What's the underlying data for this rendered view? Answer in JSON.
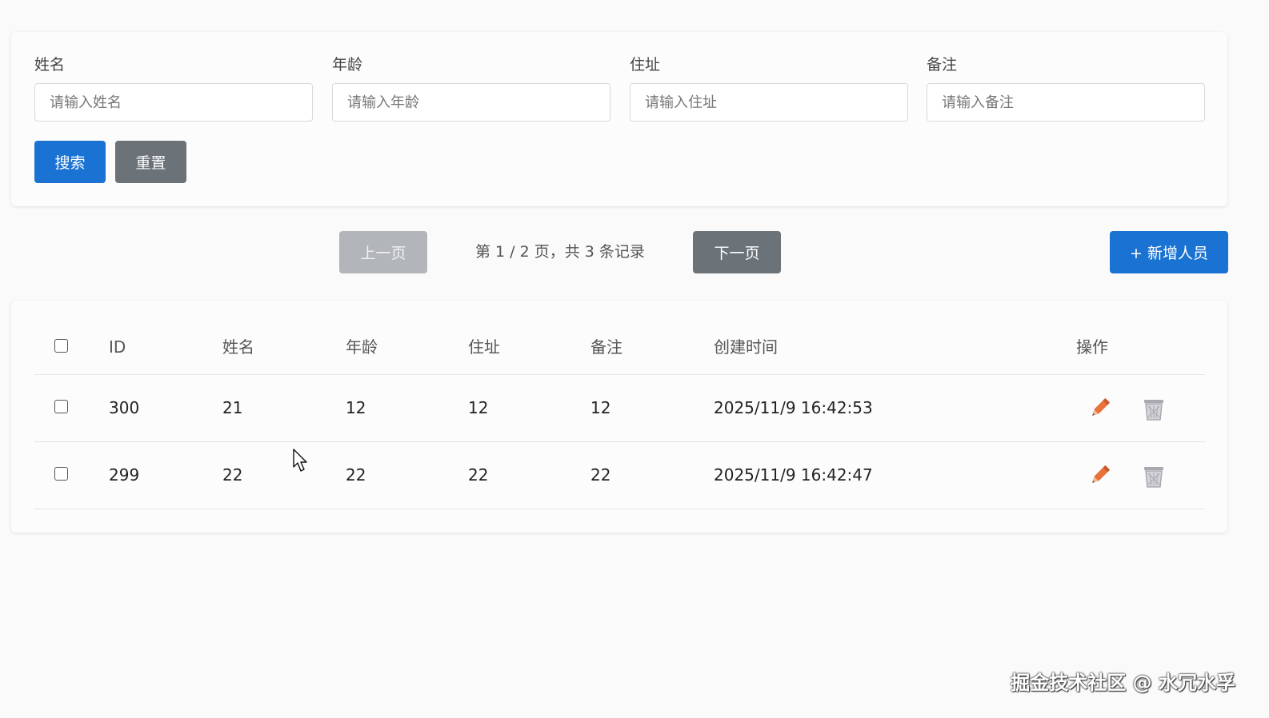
{
  "search": {
    "fields": [
      {
        "label": "姓名",
        "placeholder": "请输入姓名"
      },
      {
        "label": "年龄",
        "placeholder": "请输入年龄"
      },
      {
        "label": "住址",
        "placeholder": "请输入住址"
      },
      {
        "label": "备注",
        "placeholder": "请输入备注"
      }
    ],
    "search_label": "搜索",
    "reset_label": "重置"
  },
  "pagination": {
    "prev_label": "上一页",
    "info": "第 1 / 2 页，共 3 条记录",
    "next_label": "下一页",
    "current_page": 1,
    "total_pages": 2,
    "total_records": 3
  },
  "add_button_label": "+ 新增人员",
  "table": {
    "columns": [
      "ID",
      "姓名",
      "年龄",
      "住址",
      "备注",
      "创建时间",
      "操作"
    ],
    "rows": [
      {
        "id": "300",
        "name": "21",
        "age": "12",
        "address": "12",
        "note": "12",
        "created": "2025/11/9 16:42:53",
        "checked": false
      },
      {
        "id": "299",
        "name": "22",
        "age": "22",
        "address": "22",
        "note": "22",
        "created": "2025/11/9 16:42:47",
        "checked": false
      }
    ],
    "actions": {
      "edit_icon": "pencil-icon",
      "delete_icon": "trash-icon"
    }
  },
  "colors": {
    "primary": "#1a73d2",
    "secondary": "#6b7278",
    "disabled": "#b2b6ba",
    "edit_icon": "#e8723a",
    "delete_icon": "#a9a9b0"
  },
  "watermark": "掘金技术社区 @ 水冗水孚"
}
